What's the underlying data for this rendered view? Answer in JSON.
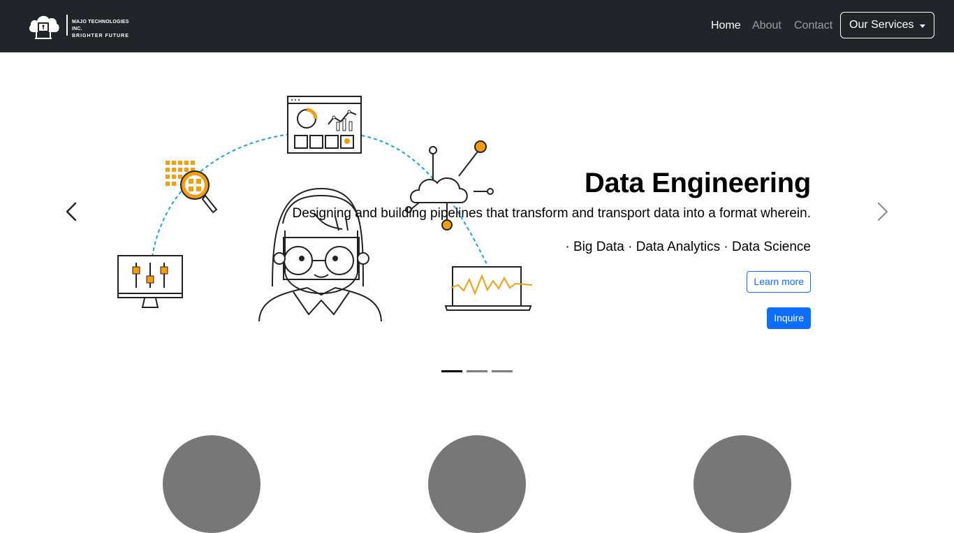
{
  "navbar": {
    "brand": {
      "line1": "MAJO TECHNOLOGIES INC.",
      "line2": "BRIGHTER FUTURE"
    },
    "links": [
      {
        "label": "Home",
        "active": true
      },
      {
        "label": "About",
        "active": false
      },
      {
        "label": "Contact",
        "active": false
      }
    ],
    "services_label": "Our Services"
  },
  "carousel": {
    "slide": {
      "title": "Data Engineering",
      "description": "Designing and building pipelines that transform and transport data into a format wherein.",
      "tags": "· Big Data · Data Analytics · Data Science",
      "learn_more": "Learn more",
      "inquire": "Inquire"
    },
    "indicators": [
      {
        "active": true
      },
      {
        "active": false
      },
      {
        "active": false
      }
    ]
  },
  "colors": {
    "navbar_bg": "#212529",
    "primary": "#0d6efd",
    "accent_orange": "#f29d12",
    "dashed_teal": "#1aa6c9",
    "placeholder_gray": "#777777"
  }
}
